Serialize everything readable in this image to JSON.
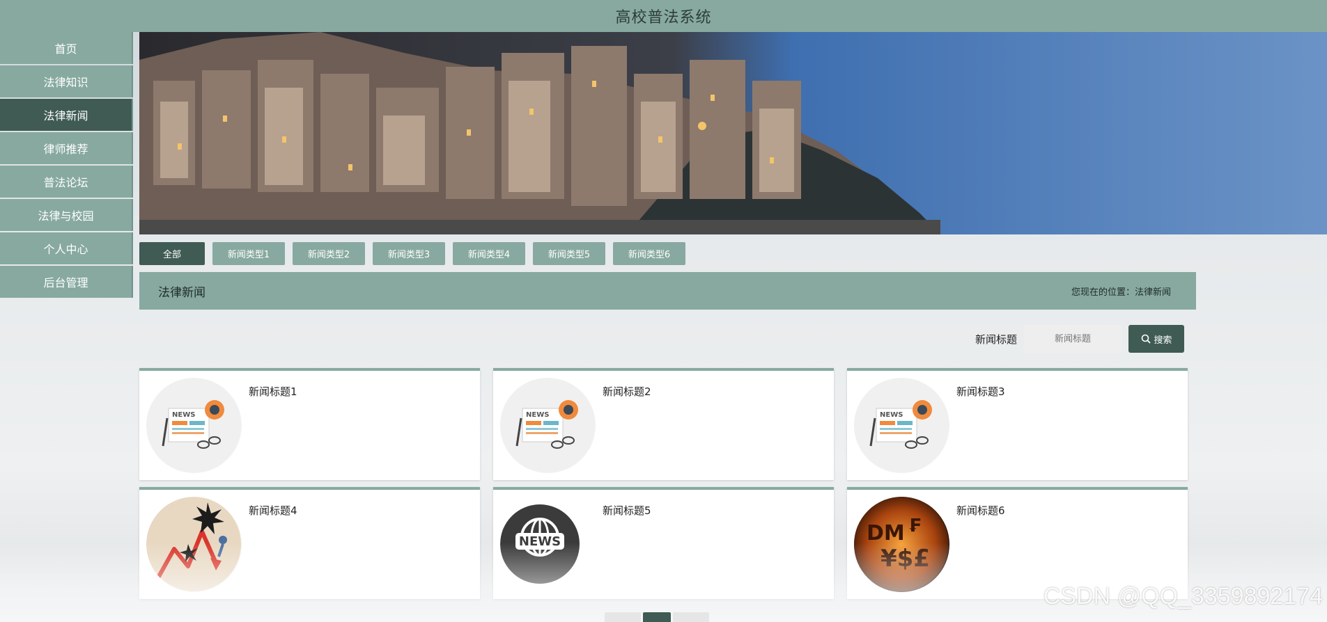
{
  "app": {
    "title": "高校普法系统"
  },
  "sidebar": {
    "items": [
      {
        "label": "首页"
      },
      {
        "label": "法律知识"
      },
      {
        "label": "法律新闻",
        "active": true
      },
      {
        "label": "律师推荐"
      },
      {
        "label": "普法论坛"
      },
      {
        "label": "法律与校园"
      },
      {
        "label": "个人中心"
      },
      {
        "label": "后台管理"
      }
    ]
  },
  "banner": {
    "image": "coastal-town-night-photo"
  },
  "tabs": [
    {
      "label": "全部",
      "active": true
    },
    {
      "label": "新闻类型1"
    },
    {
      "label": "新闻类型2"
    },
    {
      "label": "新闻类型3"
    },
    {
      "label": "新闻类型4"
    },
    {
      "label": "新闻类型5"
    },
    {
      "label": "新闻类型6"
    }
  ],
  "section": {
    "title": "法律新闻",
    "breadcrumb": "您现在的位置：法律新闻"
  },
  "search": {
    "label": "新闻标题",
    "placeholder": "新闻标题",
    "button_label": "搜索",
    "icon": "search-icon"
  },
  "cards": [
    {
      "title": "新闻标题1",
      "image": "newspaper-icon"
    },
    {
      "title": "新闻标题2",
      "image": "newspaper-icon"
    },
    {
      "title": "新闻标题3",
      "image": "newspaper-icon"
    },
    {
      "title": "新闻标题4",
      "image": "market-crash-illustration"
    },
    {
      "title": "新闻标题5",
      "image": "news-globe-badge"
    },
    {
      "title": "新闻标题6",
      "image": "currency-symbols-fire"
    }
  ],
  "watermark": "CSDN @QQ_3359892174",
  "colors": {
    "primary": "#87a9a0",
    "primary_dark": "#3f5b53"
  }
}
